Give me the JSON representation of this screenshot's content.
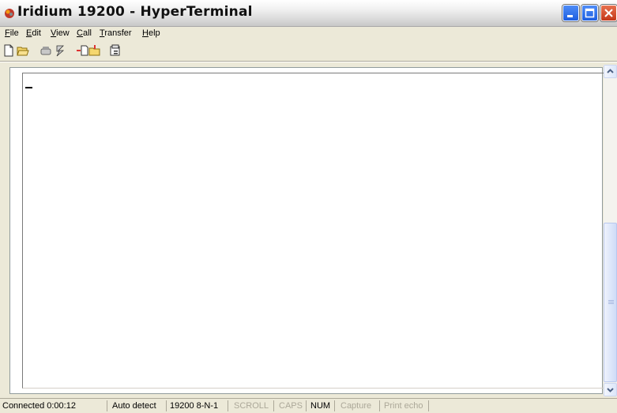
{
  "window": {
    "title": "Iridium 19200 - HyperTerminal"
  },
  "menu": [
    {
      "pre": "",
      "u": "F",
      "post": "ile"
    },
    {
      "pre": "",
      "u": "E",
      "post": "dit"
    },
    {
      "pre": "",
      "u": "V",
      "post": "iew"
    },
    {
      "pre": "",
      "u": "C",
      "post": "all"
    },
    {
      "pre": "",
      "u": "T",
      "post": "ransfer"
    },
    {
      "pre": "",
      "u": "H",
      "post": "elp"
    }
  ],
  "toolbar": {
    "icons": [
      "new-file-icon",
      "open-folder-icon",
      "call-phone-icon",
      "disconnect-phone-icon",
      "send-file-icon",
      "receive-file-icon",
      "properties-icon"
    ]
  },
  "status": {
    "connected": "Connected 0:00:12",
    "detect": "Auto detect",
    "settings": "19200 8-N-1",
    "scroll": "SCROLL",
    "caps": "CAPS",
    "num": "NUM",
    "capture": "Capture",
    "print_echo": "Print echo"
  },
  "colors": {
    "titlebar": "#dcdcdc",
    "terminal_bg": "#ffffff",
    "status_dim": "#aca899"
  }
}
